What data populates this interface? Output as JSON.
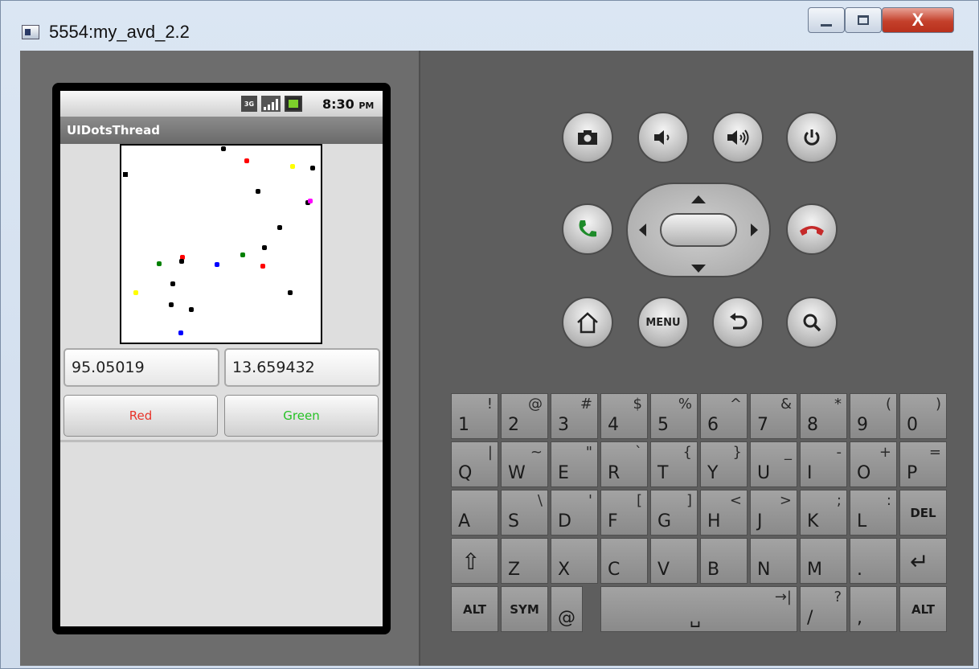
{
  "window": {
    "title": "5554:my_avd_2.2",
    "close_label": "X"
  },
  "statusbar": {
    "network_badge": "3G",
    "time": "8:30",
    "ampm": "PM"
  },
  "app": {
    "title": "UIDotsThread",
    "coord_x": "95.05019",
    "coord_y": "13.659432",
    "red_button": "Red",
    "green_button": "Green"
  },
  "controls": {
    "menu_label": "MENU",
    "colors": {
      "call_green": "#1e8b2a",
      "end_red": "#c52a2a"
    }
  },
  "dots": [
    {
      "color": "black"
    },
    {
      "color": "red"
    },
    {
      "color": "yellow"
    },
    {
      "color": "black"
    },
    {
      "color": "black"
    },
    {
      "color": "black"
    },
    {
      "color": "magenta"
    },
    {
      "color": "black"
    },
    {
      "color": "black"
    },
    {
      "color": "green"
    },
    {
      "color": "red"
    },
    {
      "color": "black"
    },
    {
      "color": "green"
    },
    {
      "color": "blue"
    },
    {
      "color": "red"
    },
    {
      "color": "black"
    },
    {
      "color": "yellow"
    },
    {
      "color": "black"
    },
    {
      "color": "black"
    },
    {
      "color": "black"
    },
    {
      "color": "blue"
    }
  ],
  "keyboard": {
    "rows": [
      [
        {
          "main": "1",
          "alt": "!"
        },
        {
          "main": "2",
          "alt": "@"
        },
        {
          "main": "3",
          "alt": "#"
        },
        {
          "main": "4",
          "alt": "$"
        },
        {
          "main": "5",
          "alt": "%"
        },
        {
          "main": "6",
          "alt": "^"
        },
        {
          "main": "7",
          "alt": "&"
        },
        {
          "main": "8",
          "alt": "*"
        },
        {
          "main": "9",
          "alt": "("
        },
        {
          "main": "0",
          "alt": ")"
        }
      ],
      [
        {
          "main": "Q",
          "alt": "|"
        },
        {
          "main": "W",
          "alt": "~"
        },
        {
          "main": "E",
          "alt": "\""
        },
        {
          "main": "R",
          "alt": "`"
        },
        {
          "main": "T",
          "alt": "{"
        },
        {
          "main": "Y",
          "alt": "}"
        },
        {
          "main": "U",
          "alt": "_"
        },
        {
          "main": "I",
          "alt": "-"
        },
        {
          "main": "O",
          "alt": "+"
        },
        {
          "main": "P",
          "alt": "="
        }
      ],
      [
        {
          "main": "A",
          "alt": ""
        },
        {
          "main": "S",
          "alt": "\\"
        },
        {
          "main": "D",
          "alt": "'"
        },
        {
          "main": "F",
          "alt": "["
        },
        {
          "main": "G",
          "alt": "]"
        },
        {
          "main": "H",
          "alt": "<"
        },
        {
          "main": "J",
          "alt": ">"
        },
        {
          "main": "K",
          "alt": ";"
        },
        {
          "main": "L",
          "alt": ":"
        },
        {
          "main": "DEL",
          "alt": ""
        }
      ],
      [
        {
          "main": "⇧",
          "alt": ""
        },
        {
          "main": "Z",
          "alt": ""
        },
        {
          "main": "X",
          "alt": ""
        },
        {
          "main": "C",
          "alt": ""
        },
        {
          "main": "V",
          "alt": ""
        },
        {
          "main": "B",
          "alt": ""
        },
        {
          "main": "N",
          "alt": ""
        },
        {
          "main": "M",
          "alt": ""
        },
        {
          "main": ".",
          "alt": ""
        },
        {
          "main": "↵",
          "alt": ""
        }
      ]
    ],
    "bottom_row": [
      {
        "main": "ALT",
        "alt": ""
      },
      {
        "main": "SYM",
        "alt": ""
      },
      {
        "main": "@",
        "alt": ""
      },
      {
        "main": "␣",
        "alt": "→|"
      },
      {
        "main": "/",
        "alt": "?"
      },
      {
        "main": ",",
        "alt": ""
      },
      {
        "main": "ALT",
        "alt": ""
      }
    ]
  }
}
